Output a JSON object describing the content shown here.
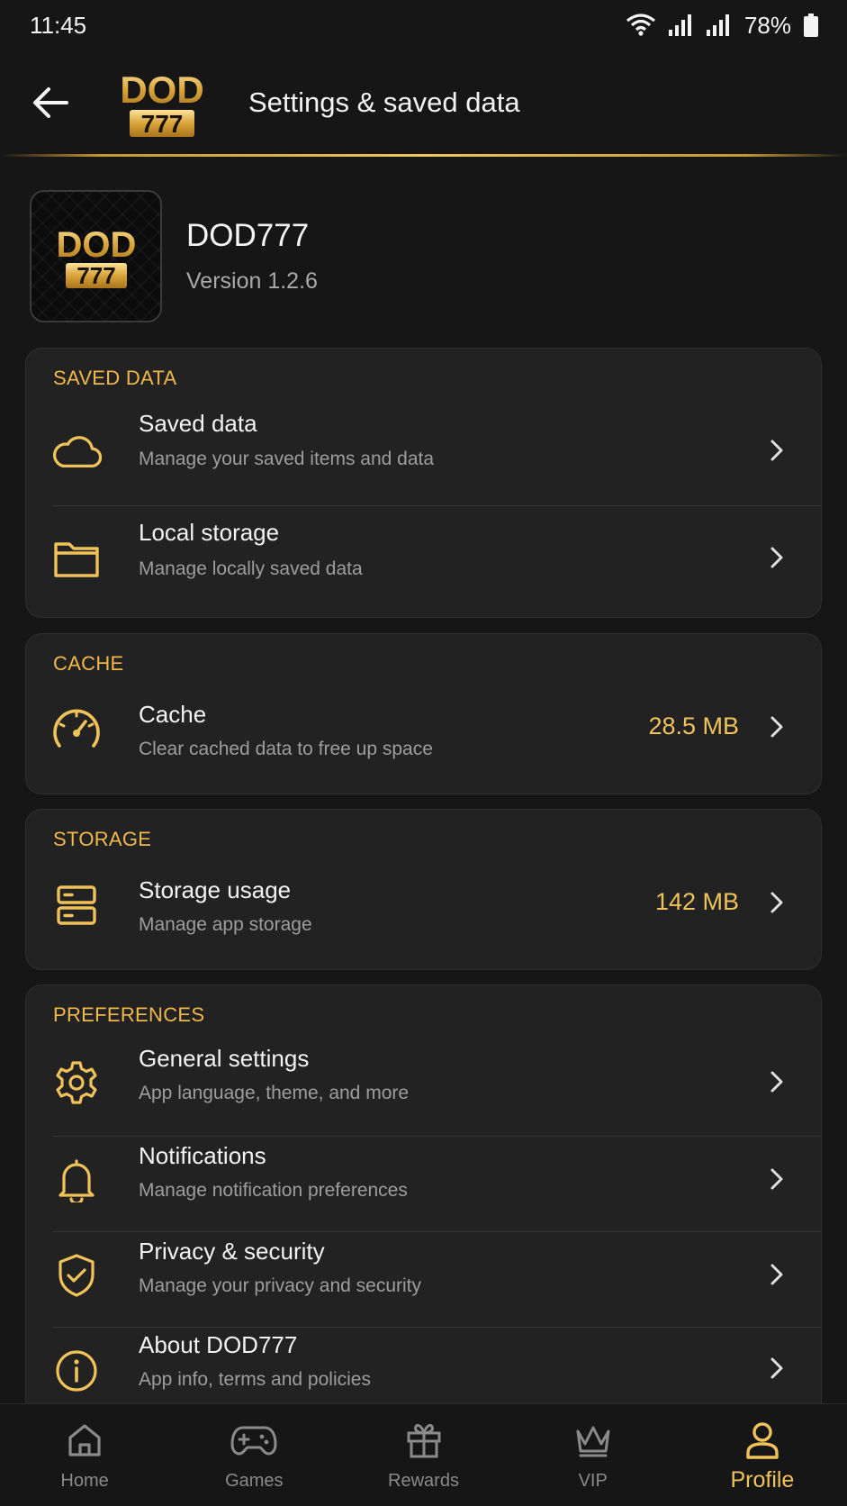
{
  "status": {
    "time": "11:45",
    "battery": "78%"
  },
  "header": {
    "title": "Settings & saved data",
    "logo_top": "DOD",
    "logo_bottom": "777"
  },
  "app": {
    "name": "DOD777",
    "version": "Version 1.2.6"
  },
  "sections": {
    "saved": {
      "title": "SAVED DATA",
      "items": [
        {
          "title": "Saved data",
          "subtitle": "Manage your saved items and data",
          "icon": "cloud-icon"
        },
        {
          "title": "Local storage",
          "subtitle": "Manage locally saved data",
          "icon": "folder-icon"
        }
      ]
    },
    "cache": {
      "title": "CACHE",
      "items": [
        {
          "title": "Cache",
          "subtitle": "Clear cached data to free up space",
          "value": "28.5 MB",
          "icon": "speedometer-icon"
        }
      ]
    },
    "storage": {
      "title": "STORAGE",
      "items": [
        {
          "title": "Storage usage",
          "subtitle": "Manage app storage",
          "value": "142 MB",
          "icon": "server-icon"
        }
      ]
    },
    "preferences": {
      "title": "PREFERENCES",
      "items": [
        {
          "title": "General settings",
          "subtitle": "App language, theme, and more",
          "icon": "gear-icon"
        },
        {
          "title": "Notifications",
          "subtitle": "Manage notification preferences",
          "icon": "bell-icon"
        },
        {
          "title": "Privacy & security",
          "subtitle": "Manage your privacy and security",
          "icon": "shield-check-icon"
        },
        {
          "title": "About DOD777",
          "subtitle": "App info, terms and policies",
          "icon": "info-icon"
        }
      ]
    }
  },
  "nav": [
    {
      "label": "Home",
      "icon": "home-icon"
    },
    {
      "label": "Games",
      "icon": "gamepad-icon"
    },
    {
      "label": "Rewards",
      "icon": "gift-icon"
    },
    {
      "label": "VIP",
      "icon": "crown-icon"
    },
    {
      "label": "Profile",
      "icon": "user-icon",
      "active": true
    }
  ],
  "colors": {
    "accent": "#f0c25a",
    "background": "#161616",
    "card": "#222222"
  }
}
